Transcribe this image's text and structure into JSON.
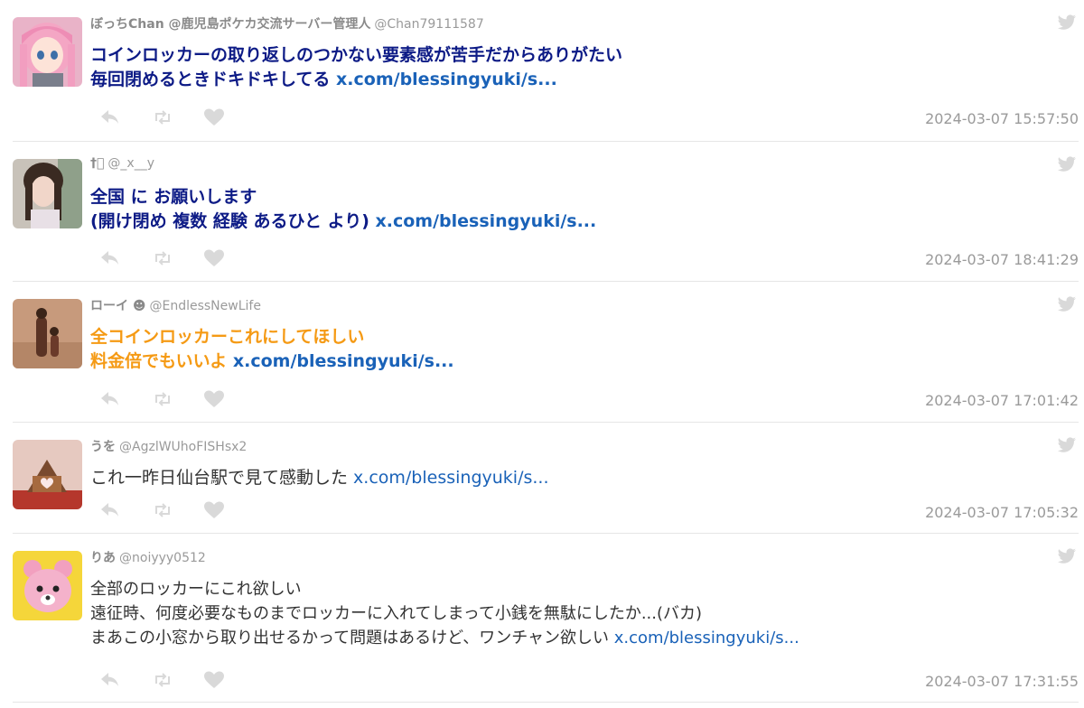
{
  "colors": {
    "navy_text": "#0d1b86",
    "orange_text": "#f59a14",
    "plain_text": "#333333",
    "link": "#1a62b8",
    "meta": "#9a9a9a",
    "icons": "#d9d9d9"
  },
  "icons": {
    "reply": "reply-icon",
    "retweet": "retweet-icon",
    "like": "heart-icon",
    "source": "bird-icon"
  },
  "tweets": [
    {
      "name": "ぼっちChan @鹿児島ポケカ交流サーバー管理人",
      "handle": "@Chan79111587",
      "lines": [
        "コインロッカーの取り返しのつかない要素感が苦手だからありがたい",
        "毎回閉めるときドキドキしてる "
      ],
      "link": "x.com/blessingyuki/s...",
      "timestamp": "2024-03-07 15:57:50",
      "color": "#0d1b86"
    },
    {
      "name": "†⃞",
      "handle": "@_x__y",
      "lines": [
        "全国 に お願いします",
        "(開け閉め 複数 経験 あるひと より) "
      ],
      "link": "x.com/blessingyuki/s...",
      "timestamp": "2024-03-07 18:41:29",
      "color": "#0d1b86"
    },
    {
      "name": "ローイ ☻",
      "handle": "@EndlessNewLife",
      "lines": [
        "全コインロッカーこれにしてほしい",
        "料金倍でもいいよ "
      ],
      "link": "x.com/blessingyuki/s...",
      "timestamp": "2024-03-07 17:01:42",
      "color": "#f59a14"
    },
    {
      "name": "うを",
      "handle": "@AgzlWUhoFISHsx2",
      "lines": [
        "これ一昨日仙台駅で見て感動した "
      ],
      "link": "x.com/blessingyuki/s...",
      "timestamp": "2024-03-07 17:05:32",
      "color": "#333333"
    },
    {
      "name": "りあ",
      "handle": "@noiyyy0512",
      "lines": [
        "全部のロッカーにこれ欲しい",
        "遠征時、何度必要なものまでロッカーに入れてしまって小銭を無駄にしたか...(バカ)",
        "まあこの小窓から取り出せるかって問題はあるけど、ワンチャン欲しい "
      ],
      "link": "x.com/blessingyuki/s...",
      "timestamp": "2024-03-07 17:31:55",
      "color": "#333333"
    }
  ]
}
